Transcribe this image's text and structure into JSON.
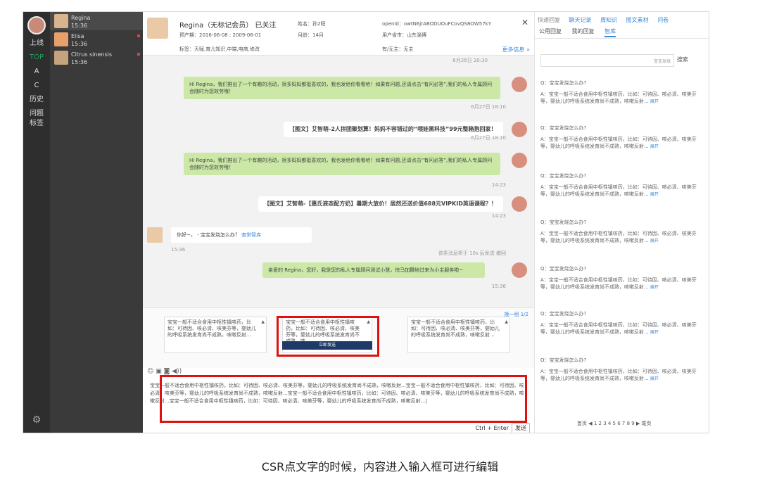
{
  "nav": {
    "items": [
      "上线",
      "TOP",
      "A",
      "C",
      "历史",
      "问题标签"
    ],
    "gear_icon": "gear-icon"
  },
  "contacts": [
    {
      "name": "Regina",
      "time": "15:36",
      "unread": false
    },
    {
      "name": "Elisa",
      "time": "15:36",
      "unread": true
    },
    {
      "name": "Citrus sinensis",
      "time": "15:36",
      "unread": true
    }
  ],
  "header": {
    "name": "Regina（无标记会员） 已关注",
    "line1": "预产期：2016-06-08 ; 2009-06-01",
    "month": "月龄：14月",
    "nickname": "姓名：孙2阳",
    "openid": "openid：owtN6jrABODUOuFCovQS8OW57kY",
    "province": "用户省市：山东淄博",
    "tags": "标签：天赋,育儿知识,中端,电商,修改",
    "has_baby": "有/无主：无主",
    "more": "更多信息 »",
    "close": "✕"
  },
  "messages": {
    "ts_top": "6月26日 20:30",
    "m1": "Hi Regina，我们推出了一个有趣的活动，很多妈妈都挺喜欢的，我也发给你看看哈！如果有问题,还请点击“有问必答”,我们的私人专属顾问会随时为您效劳哦！",
    "ts1": "6月27日 18:10",
    "m2": "【图文】艾智萌-2人拼团聚划算！妈妈不容错过的“喂娃黑科技”99元整箱抱回家！",
    "ts2": "6月27日 18:10",
    "m3": "Hi Regina，我们推出了一个有趣的活动，很多妈妈都挺喜欢的，我也发给你看看哈！如果有问题,还请点击“有问必答”,我们的私人专属顾问会随时为您效劳哦！",
    "ts3": "14:23",
    "m4": "【图文】艾智萌-【惠氏液态配方奶】暑期大放价！居然还送价值688元VIPKID英语课程？！",
    "ts4": "14:23",
    "m5": "你好~。 - 宝宝发烧怎么办？",
    "m5_link": "查常智库",
    "ts5": "15:36",
    "m5_note": "该条消息将于 10s 后发送 撤回",
    "m6": "亲爱的 Regina，您好，我是您的私人专属顾问测试小慧，快马加鞭地过来为小主服务啦~",
    "ts6": "15:36"
  },
  "suggestions": {
    "refresh": "换一组 1/2",
    "cards": [
      "宝宝一般不适合食用中枢性镇咳药，比如：可待因、咳必清、咳美芬等，婴幼儿的呼吸系统发育尚不成熟，咳嗽反射...",
      "宝宝一般不适合食用中枢性镇咳药，比如：可待因、咳必清、咳美芬等，婴幼儿的呼吸系统发育尚不成熟，咳",
      "宝宝一般不适合食用中枢性镇咳药，比如：可待因、咳必清、咳美芬等，婴幼儿的呼吸系统发育尚不成熟，咳嗽反射..."
    ],
    "send_now": "立即发送"
  },
  "input": {
    "text": "宝宝一般不适合食用中枢性镇咳药，比如：可待因、咳必清、咳美芬等，婴幼儿的呼吸系统发育尚不成熟，咳嗽反射...宝宝一般不适合食用中枢性镇咳药，比如：可待因、咳必清、咳美芬等，婴幼儿的呼吸系统发育尚不成熟，咳嗽反射...宝宝一般不适合食用中枢性镇咳药，比如：可待因、咳必清、咳美芬等，婴幼儿的呼吸系统发育尚不成熟，咳嗽反射...宝宝一般不适合食用中枢性镇咳药，比如：可待因、咳必清、咳美芬等，婴幼儿的呼吸系统发育尚不成熟，咳嗽反射...|",
    "hint": "Ctrl + Enter",
    "send": "发送"
  },
  "right": {
    "tabs": [
      "快速回复",
      "聊天记录",
      "周知识",
      "图文素材",
      "问卷"
    ],
    "subtabs": [
      "公用回复",
      "我的回复",
      "智库"
    ],
    "search_placeholder": "宝宝发烧",
    "search_btn": "搜索",
    "q": "Q：宝宝发烧怎么办?",
    "a": "A：宝宝一般不适合食用中枢性镇咳药，比如：可待因、咳必清、咳美芬等，婴幼儿的呼吸系统发育尚不成熟，咳嗽反射...",
    "expand": "展开",
    "pager": "首页 ◀ 1 2 3 4 5 6 7 8 9 ▶ 尾页"
  },
  "caption": "CSR点文字的时候，内容进入输入框可进行编辑",
  "colors": {
    "accent": "#3a8ad8",
    "bubble_green": "#cbe8a6",
    "highlight_red": "#e01010"
  }
}
